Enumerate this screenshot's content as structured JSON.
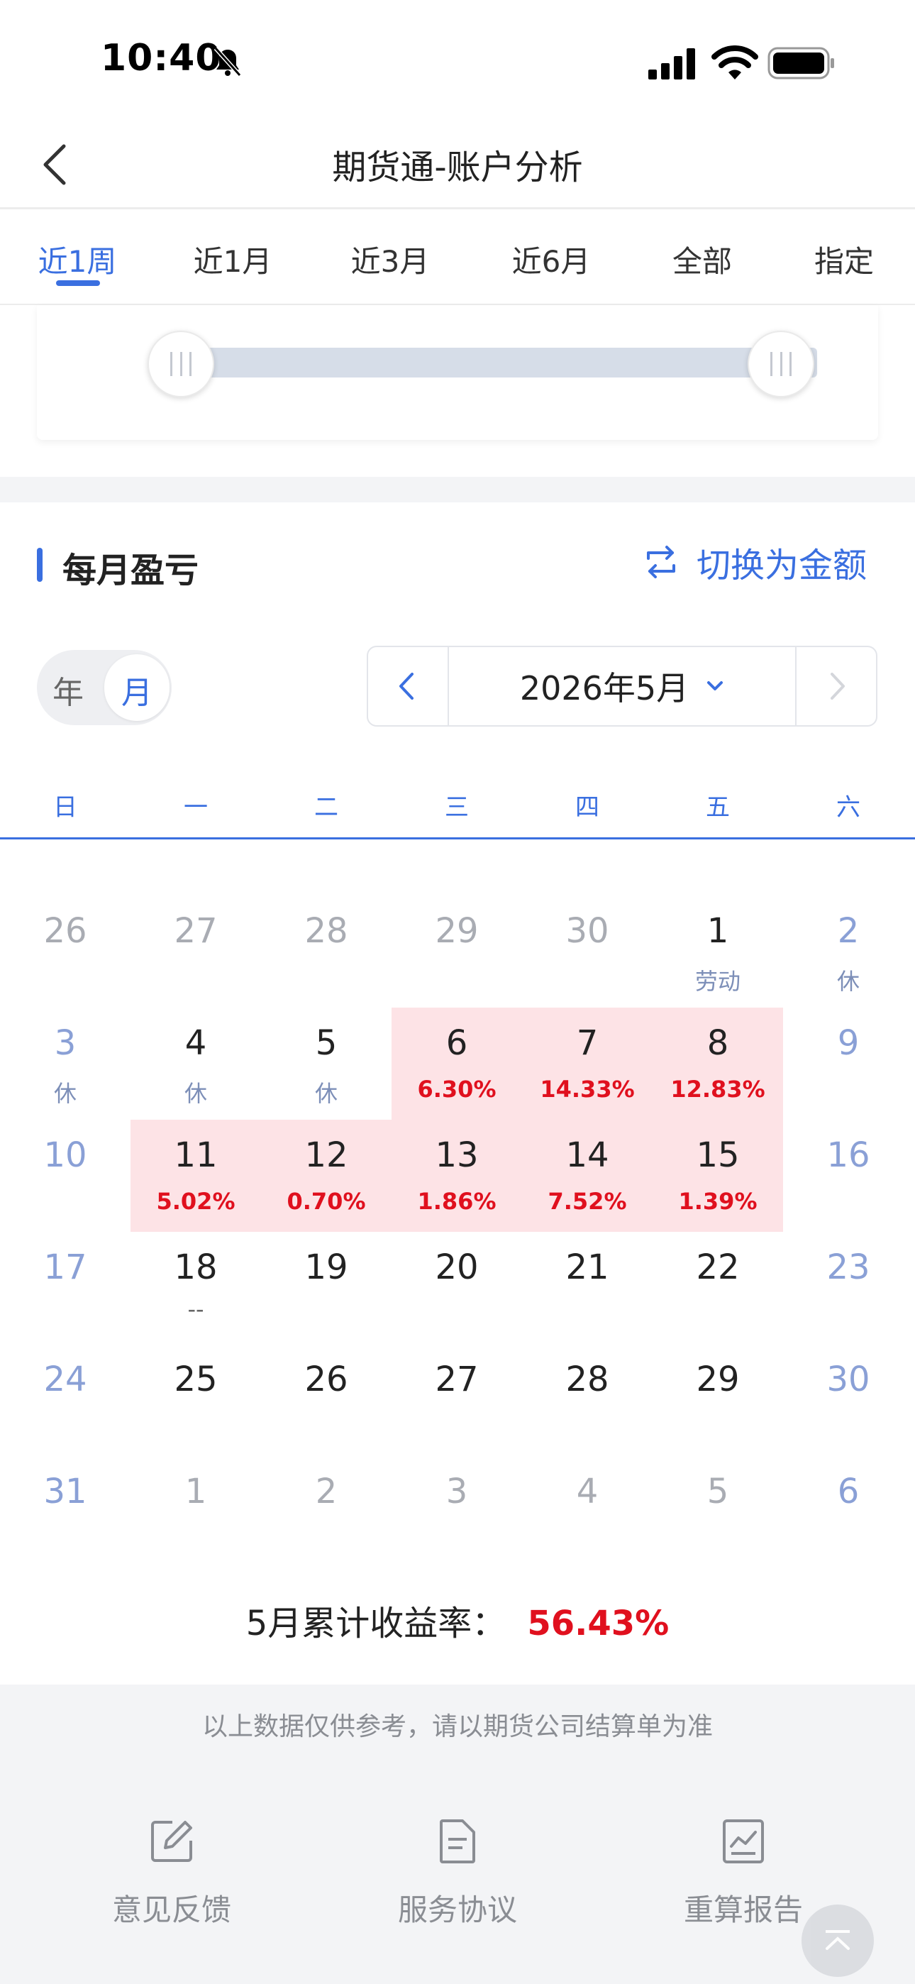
{
  "status_bar": {
    "time": "10:40"
  },
  "nav": {
    "title": "期货通-账户分析"
  },
  "tabs": [
    {
      "label": "近1周",
      "active": true
    },
    {
      "label": "近1月",
      "active": false
    },
    {
      "label": "近3月",
      "active": false
    },
    {
      "label": "近6月",
      "active": false
    },
    {
      "label": "全部",
      "active": false
    },
    {
      "label": "指定",
      "active": false
    }
  ],
  "section": {
    "title": "每月盈亏",
    "switch_label": "切换为金额"
  },
  "period_toggle": {
    "year": "年",
    "month": "月",
    "selected": "月"
  },
  "month_picker": {
    "label": "2026年5月"
  },
  "weekdays": [
    "日",
    "一",
    "二",
    "三",
    "四",
    "五",
    "六"
  ],
  "calendar": [
    [
      {
        "day": "26",
        "type": "out"
      },
      {
        "day": "27",
        "type": "out"
      },
      {
        "day": "28",
        "type": "out"
      },
      {
        "day": "29",
        "type": "out"
      },
      {
        "day": "30",
        "type": "out"
      },
      {
        "day": "1",
        "note": "劳动"
      },
      {
        "day": "2",
        "type": "weekend",
        "note": "休"
      }
    ],
    [
      {
        "day": "3",
        "type": "weekend",
        "note": "休"
      },
      {
        "day": "4",
        "note": "休"
      },
      {
        "day": "5",
        "note": "休"
      },
      {
        "day": "6",
        "pct": "6.30%"
      },
      {
        "day": "7",
        "pct": "14.33%"
      },
      {
        "day": "8",
        "pct": "12.83%"
      },
      {
        "day": "9",
        "type": "weekend"
      }
    ],
    [
      {
        "day": "10",
        "type": "weekend"
      },
      {
        "day": "11",
        "pct": "5.02%"
      },
      {
        "day": "12",
        "pct": "0.70%"
      },
      {
        "day": "13",
        "pct": "1.86%"
      },
      {
        "day": "14",
        "pct": "7.52%"
      },
      {
        "day": "15",
        "pct": "1.39%"
      },
      {
        "day": "16",
        "type": "weekend"
      }
    ],
    [
      {
        "day": "17",
        "type": "weekend"
      },
      {
        "day": "18",
        "dash": "--"
      },
      {
        "day": "19"
      },
      {
        "day": "20"
      },
      {
        "day": "21"
      },
      {
        "day": "22"
      },
      {
        "day": "23",
        "type": "weekend"
      }
    ],
    [
      {
        "day": "24",
        "type": "weekend"
      },
      {
        "day": "25"
      },
      {
        "day": "26"
      },
      {
        "day": "27"
      },
      {
        "day": "28"
      },
      {
        "day": "29"
      },
      {
        "day": "30",
        "type": "weekend"
      }
    ],
    [
      {
        "day": "31",
        "type": "weekend"
      },
      {
        "day": "1",
        "type": "out"
      },
      {
        "day": "2",
        "type": "out"
      },
      {
        "day": "3",
        "type": "out"
      },
      {
        "day": "4",
        "type": "out"
      },
      {
        "day": "5",
        "type": "out"
      },
      {
        "day": "6",
        "type": "weekend"
      }
    ]
  ],
  "summary": {
    "label": "5月累计收益率：",
    "value": "56.43%"
  },
  "footer": {
    "disclaimer": "以上数据仅供参考，请以期货公司结算单为准",
    "items": [
      {
        "label": "意见反馈",
        "icon": "edit-icon"
      },
      {
        "label": "服务协议",
        "icon": "document-icon"
      },
      {
        "label": "重算报告",
        "icon": "chart-report-icon"
      }
    ]
  },
  "colors": {
    "accent": "#3a6fe0",
    "profit_text": "#e0101e",
    "profit_bg": "#fde3e6"
  }
}
